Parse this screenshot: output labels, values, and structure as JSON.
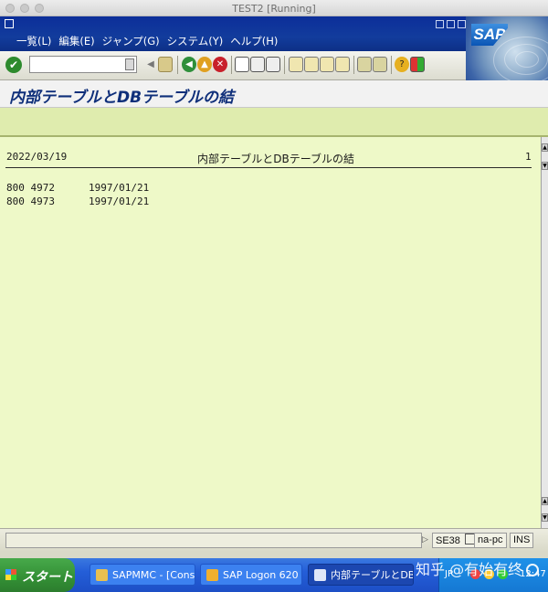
{
  "window": {
    "title": "TEST2 [Running]"
  },
  "menu": {
    "items": [
      "一覧(L)",
      "編集(E)",
      "ジャンプ(G)",
      "システム(Y)",
      "ヘルプ(H)"
    ]
  },
  "logo": {
    "text": "SAP"
  },
  "toolbar": {
    "command_value": ""
  },
  "screen": {
    "title": "内部テーブルとDBテーブルの結"
  },
  "list": {
    "date": "2022/03/19",
    "title": "内部テーブルとDBテーブルの結",
    "page": "1",
    "rows": [
      {
        "key": "800 4972",
        "date": "1997/01/21"
      },
      {
        "key": "800 4973",
        "date": "1997/01/21"
      }
    ]
  },
  "status": {
    "transaction": "SE38",
    "server": "na-pc",
    "mode": "INS"
  },
  "taskbar": {
    "start_label": "スタート",
    "tasks": [
      "SAPMMC - [Console...",
      "SAP Logon 620",
      "内部テーブルとDBテー..."
    ],
    "tray_lang": "JP",
    "clock": "12:47"
  },
  "watermark": {
    "text": "知乎 @有始有终"
  },
  "colors": {
    "sap_blue": "#123c9c",
    "list_background": "#eef9c8",
    "title_text": "#0f2f7a",
    "taskbar_blue": "#245ed8",
    "start_green": "#338f35"
  }
}
